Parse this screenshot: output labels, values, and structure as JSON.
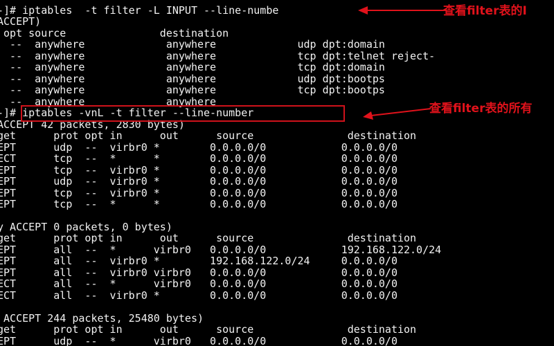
{
  "terminal": {
    "lines": [
      "-]# iptables  -t filter -L INPUT --line-numbe",
      "ACCEPT)",
      " opt source               destination",
      "  --  anywhere             anywhere             udp dpt:domain",
      "  --  anywhere             anywhere             tcp dpt:telnet reject-",
      "  --  anywhere             anywhere             tcp dpt:domain",
      "  --  anywhere             anywhere             udp dpt:bootps",
      "  --  anywhere             anywhere             tcp dpt:bootps",
      "  --  anywhere             anywhere",
      "-]# iptables -vnL -t filter --line-number",
      "ACCEPT 42 packets, 2830 bytes)",
      "get      prot opt in      out      source               destination",
      "EPT      udp  --  virbr0 *        0.0.0.0/0            0.0.0.0/0",
      "ECT      tcp  --  *      *        0.0.0.0/0            0.0.0.0/0",
      "EPT      tcp  --  virbr0 *        0.0.0.0/0            0.0.0.0/0",
      "EPT      udp  --  virbr0 *        0.0.0.0/0            0.0.0.0/0",
      "EPT      tcp  --  virbr0 *        0.0.0.0/0            0.0.0.0/0",
      "EPT      tcp  --  *      *        0.0.0.0/0            0.0.0.0/0",
      "",
      "y ACCEPT 0 packets, 0 bytes)",
      "get      prot opt in      out      source               destination",
      "EPT      all  --  *      virbr0   0.0.0.0/0            192.168.122.0/24",
      "EPT      all  --  virbr0 *        192.168.122.0/24     0.0.0.0/0",
      "EPT      all  --  virbr0 virbr0   0.0.0.0/0            0.0.0.0/0",
      "ECT      all  --  *      virbr0   0.0.0.0/0            0.0.0.0/0",
      "ECT      all  --  virbr0 *        0.0.0.0/0            0.0.0.0/0",
      "",
      " ACCEPT 244 packets, 25480 bytes)",
      "get      prot opt in      out      source               destination",
      "EPT      udp  --  *      virbr0   0.0.0.0/0            0.0.0.0/0"
    ]
  },
  "annotations": {
    "note1": "查看filter表的I",
    "note2": "查看filter表的所有",
    "box_color": "#d0121b",
    "arrow_color": "#e0121b"
  }
}
